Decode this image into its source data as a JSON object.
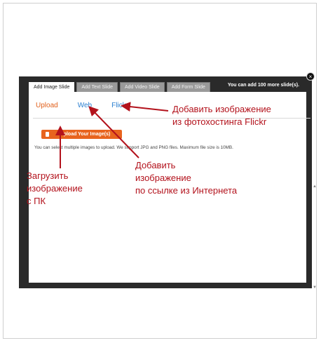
{
  "dialog": {
    "tabs": [
      {
        "label": "Add Image Slide",
        "active": true
      },
      {
        "label": "Add Text Slide",
        "active": false
      },
      {
        "label": "Add Video Slide",
        "active": false
      },
      {
        "label": "Add Form Slide",
        "active": false
      }
    ],
    "slides_note": "You can add 100 more slide(s).",
    "close_label": "×",
    "subtabs": [
      {
        "label": "Upload",
        "active": true
      },
      {
        "label": "Web",
        "active": false
      },
      {
        "label": "Flickr",
        "active": false
      }
    ],
    "upload_button_label": "Upload Your Image(s)",
    "upload_hint": "You can select multiple images to upload. We support JPG and PNG files. Maximum file size is 10MB."
  },
  "annotations": {
    "flickr": "Добавить изображение\nиз фотохостинга Flickr",
    "web": "Добавить\nизображение\nпо ссылке из Интернета",
    "upload": "Загрузить\nизображение\nс ПК"
  },
  "colors": {
    "annotation": "#b3121c",
    "accent": "#e8641e",
    "link": "#2a7fd0"
  }
}
